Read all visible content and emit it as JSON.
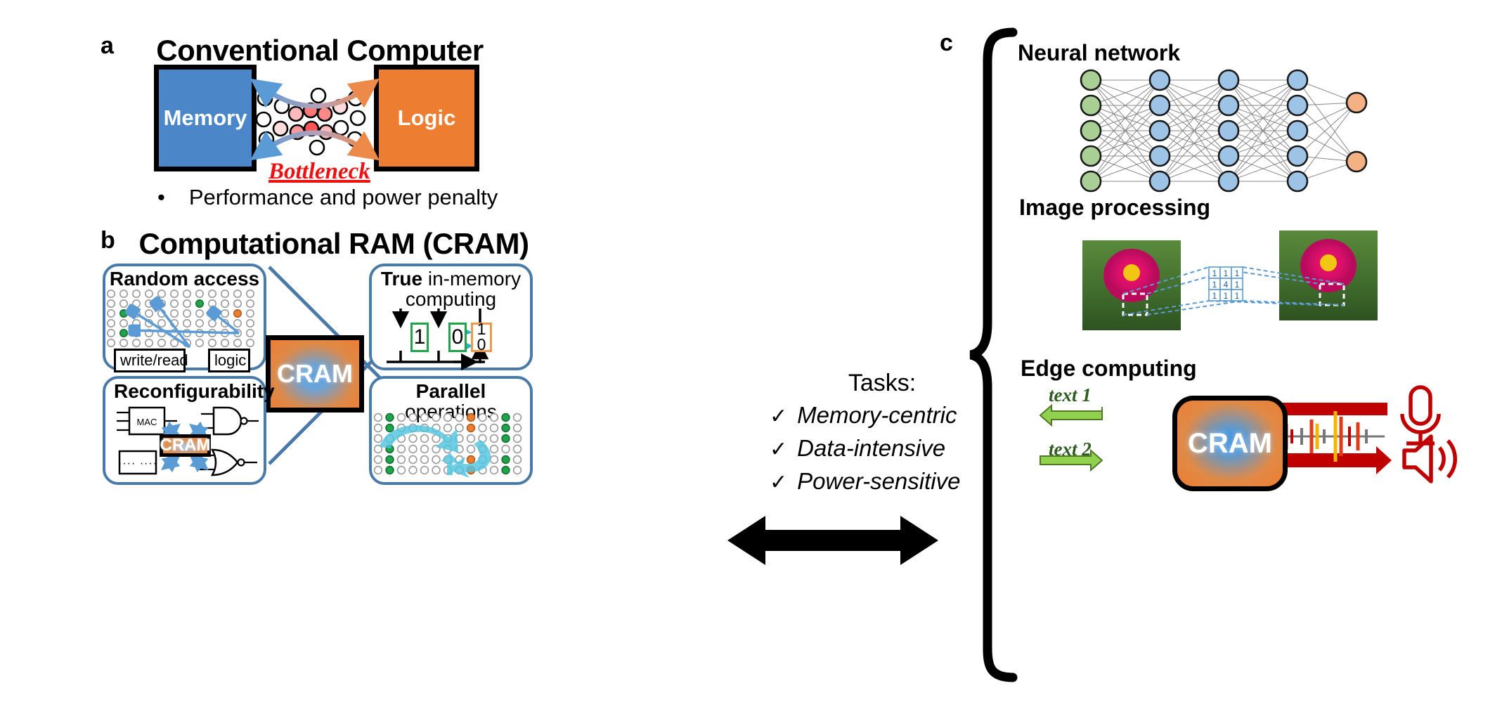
{
  "figure": {
    "panels": [
      {
        "letter": "a",
        "title": "Conventional Computer"
      },
      {
        "letter": "b",
        "title": "Computational RAM (CRAM)"
      },
      {
        "letter": "c",
        "title": ""
      }
    ]
  },
  "panel_a": {
    "letter": "a",
    "title": "Conventional Computer",
    "memory_block": "Memory",
    "logic_block": "Logic",
    "bottleneck_label": "Bottleneck",
    "bullet": "Performance and power penalty",
    "bullet_marker": "•",
    "colors": {
      "memory": "#4a86c8",
      "logic": "#ed7d31",
      "bottleneck": "#ee1111"
    }
  },
  "panel_b": {
    "letter": "b",
    "title": "Computational RAM (CRAM)",
    "core_label": "CRAM",
    "boxes": {
      "random_access": {
        "title": "Random access",
        "label_write_read": "write/read",
        "label_logic": "logic"
      },
      "true_in_memory": {
        "title_bold": "True",
        "title_rest": " in-memory",
        "title_line2": "computing",
        "cell_values": [
          "1",
          "0"
        ],
        "toggle_top": "1",
        "toggle_bottom": "0"
      },
      "reconfigurability": {
        "title": "Reconfigurability",
        "mac_label": "MAC",
        "dots_label": "····   ····",
        "cram_label": "CRAM",
        "gate_top": "NAND",
        "gate_bottom": "NOR"
      },
      "parallel_operations": {
        "title_bold": "Parallel",
        "title_line2": "operations"
      }
    },
    "colors": {
      "outline": "#4a7ba8",
      "green_cell": "#1fa44a",
      "orange_cell": "#ed7d31",
      "arrow_cyan": "#2ab0d0",
      "arrow_blue": "#5b9bd5"
    }
  },
  "tasks": {
    "heading": "Tasks:",
    "check_glyph": "✓",
    "items": [
      "Memory-centric",
      "Data-intensive",
      "Power-sensitive"
    ]
  },
  "panel_c": {
    "letter": "c",
    "sections": [
      {
        "title": "Neural network"
      },
      {
        "title": "Image processing"
      },
      {
        "title": "Edge computing"
      }
    ],
    "neural_network": {
      "title": "Neural network",
      "layers": [
        {
          "name": "input",
          "count": 5,
          "color": "#a9cf94"
        },
        {
          "name": "hidden1",
          "count": 5,
          "color": "#9dc3e6"
        },
        {
          "name": "hidden2",
          "count": 5,
          "color": "#9dc3e6"
        },
        {
          "name": "hidden3",
          "count": 5,
          "color": "#9dc3e6"
        },
        {
          "name": "output",
          "count": 2,
          "color": "#f4b183"
        }
      ]
    },
    "image_processing": {
      "title": "Image processing",
      "kernel_rows": [
        [
          "1",
          "1",
          "1"
        ],
        [
          "1",
          "4",
          "1"
        ],
        [
          "1",
          "1",
          "1"
        ]
      ]
    },
    "edge_computing": {
      "title": "Edge computing",
      "cram_label": "CRAM",
      "text_out": "text 1",
      "text_in": "text 2",
      "icons": [
        "microphone-icon",
        "speaker-icon",
        "audio-waveform-icon"
      ],
      "colors": {
        "green_arrow": "#92d050",
        "red_arrow": "#c00000",
        "text_label": "#2d5c1e"
      }
    }
  }
}
